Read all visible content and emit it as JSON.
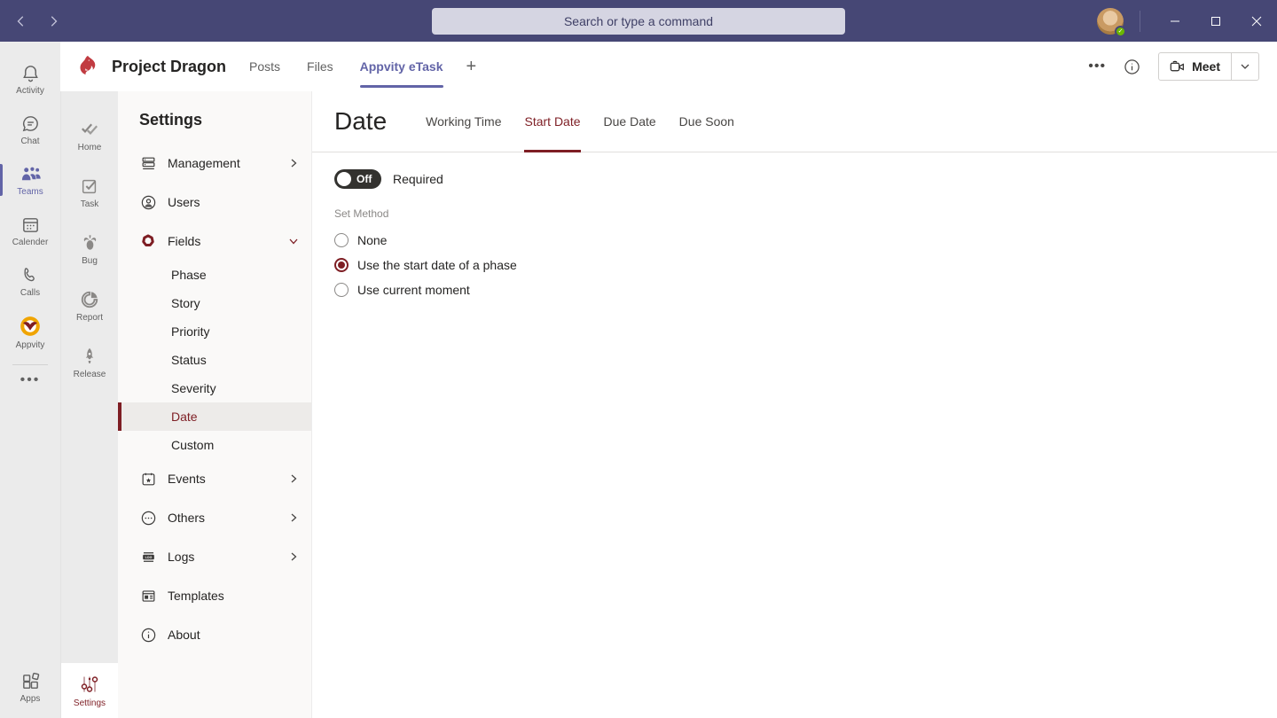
{
  "colors": {
    "topbar_bg": "#464775",
    "teams_purple": "#6264a7",
    "accent_maroon": "#7e1e24",
    "appvity_amber": "#f0a400",
    "rail_bg": "#ebebeb",
    "panel_bg": "#faf9f8",
    "presence_green": "#6bb700"
  },
  "topbar": {
    "search_placeholder": "Search or type a command"
  },
  "app_rail": {
    "items": [
      {
        "label": "Activity",
        "selected": false
      },
      {
        "label": "Chat",
        "selected": false
      },
      {
        "label": "Teams",
        "selected": true
      },
      {
        "label": "Calender",
        "selected": false
      },
      {
        "label": "Calls",
        "selected": false
      },
      {
        "label": "Appvity",
        "selected": false
      }
    ],
    "apps_label": "Apps"
  },
  "team_rail": {
    "items": [
      {
        "label": "Home"
      },
      {
        "label": "Task"
      },
      {
        "label": "Bug"
      },
      {
        "label": "Report"
      },
      {
        "label": "Release"
      }
    ],
    "settings_label": "Settings",
    "settings_selected": true
  },
  "header": {
    "team_name": "Project Dragon",
    "tabs": [
      {
        "label": "Posts",
        "selected": false
      },
      {
        "label": "Files",
        "selected": false
      },
      {
        "label": "Appvity eTask",
        "selected": true
      }
    ],
    "add_tab_glyph": "+",
    "meet_label": "Meet"
  },
  "settings_nav": {
    "title": "Settings",
    "items": {
      "management": "Management",
      "users": "Users",
      "fields": "Fields",
      "events": "Events",
      "others": "Others",
      "logs": "Logs",
      "templates": "Templates",
      "about": "About"
    },
    "fields_children": [
      {
        "label": "Phase",
        "selected": false
      },
      {
        "label": "Story",
        "selected": false
      },
      {
        "label": "Priority",
        "selected": false
      },
      {
        "label": "Status",
        "selected": false
      },
      {
        "label": "Severity",
        "selected": false
      },
      {
        "label": "Date",
        "selected": true
      },
      {
        "label": "Custom",
        "selected": false
      }
    ],
    "fields_expanded": true
  },
  "main": {
    "title": "Date",
    "tabs": [
      {
        "label": "Working Time",
        "selected": false
      },
      {
        "label": "Start Date",
        "selected": true
      },
      {
        "label": "Due Date",
        "selected": false
      },
      {
        "label": "Due Soon",
        "selected": false
      }
    ],
    "required_toggle": {
      "state": "Off",
      "label": "Required"
    },
    "set_method": {
      "label": "Set Method",
      "options": [
        {
          "label": "None",
          "selected": false
        },
        {
          "label": "Use the start date of a phase",
          "selected": true
        },
        {
          "label": "Use current moment",
          "selected": false
        }
      ]
    }
  }
}
